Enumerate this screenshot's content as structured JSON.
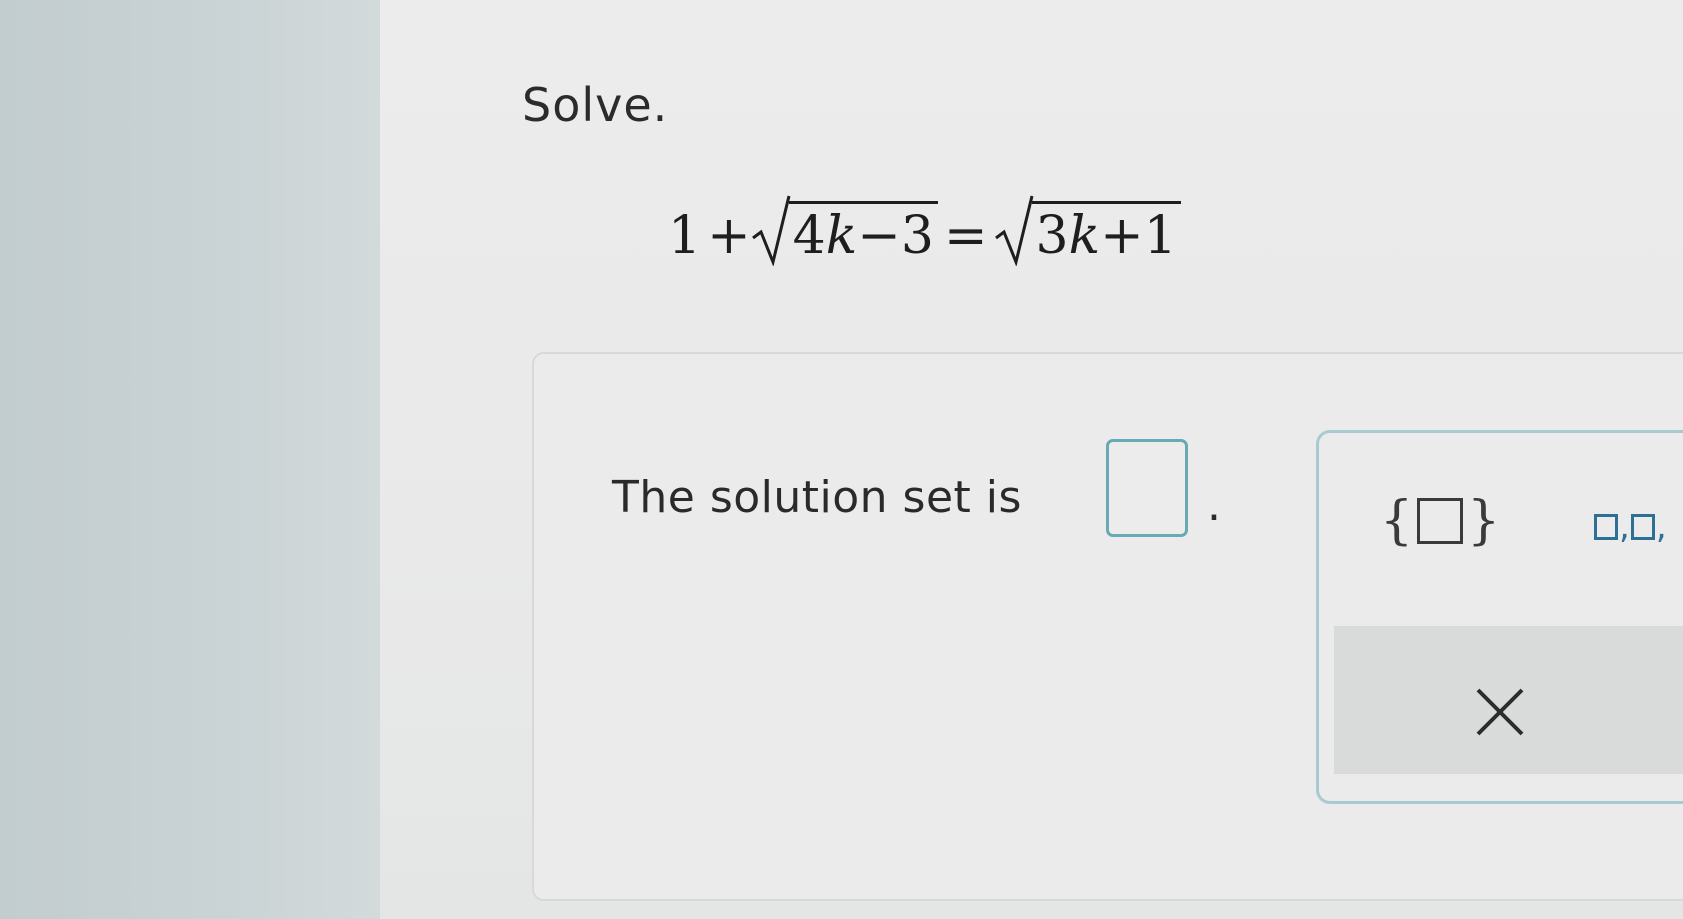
{
  "problem": {
    "instruction": "Solve.",
    "equation": {
      "constant": "1",
      "plus": "+",
      "left_radicand": {
        "coef": "4",
        "var": "k",
        "op": "−",
        "const": "3"
      },
      "equals": "=",
      "right_radicand": {
        "coef": "3",
        "var": "k",
        "op": "+",
        "const": "1"
      }
    }
  },
  "answer": {
    "prompt": "The solution set is",
    "value": "",
    "suffix": "."
  },
  "palette": {
    "set_open": "{",
    "set_close": "}",
    "list_separator": ",",
    "clear_icon": "close-icon"
  },
  "colors": {
    "input_border": "#67a9b4",
    "palette_border": "#a8cbd1",
    "list_icon": "#2e6f96"
  }
}
